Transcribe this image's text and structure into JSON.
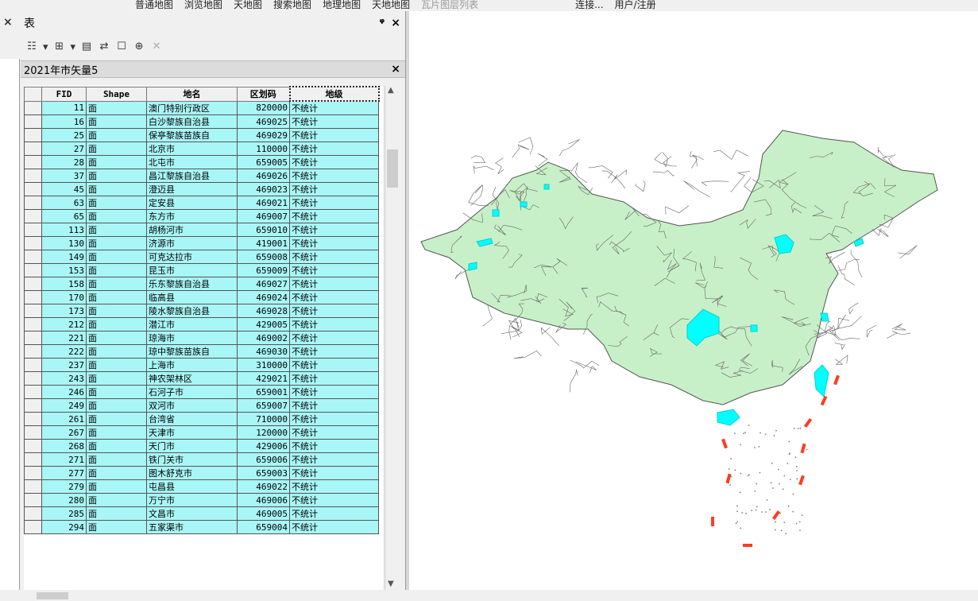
{
  "topbar": {
    "items": [
      "普通地图",
      "浏览地图",
      "天地图",
      "搜索地图",
      "地理地图",
      "天地地图"
    ],
    "search_placeholder": "瓦片图层列表",
    "items2": [
      "连接...",
      "用户/注册"
    ]
  },
  "left": {
    "close_label": "×"
  },
  "window": {
    "title": "表",
    "pin_label": "ᵠ",
    "close_label": "×"
  },
  "toolbar": {
    "delete_label": "✕"
  },
  "layer": {
    "name": "2021年市矢量5",
    "close_label": "×"
  },
  "table": {
    "columns": [
      "FID",
      "Shape",
      "地名",
      "区划码",
      "地级"
    ],
    "rows": [
      [
        "11",
        "面",
        "澳门特别行政区",
        "820000",
        "不统计"
      ],
      [
        "16",
        "面",
        "白沙黎族自治县",
        "469025",
        "不统计"
      ],
      [
        "25",
        "面",
        "保亭黎族苗族自",
        "469029",
        "不统计"
      ],
      [
        "27",
        "面",
        "北京市",
        "110000",
        "不统计"
      ],
      [
        "28",
        "面",
        "北屯市",
        "659005",
        "不统计"
      ],
      [
        "37",
        "面",
        "昌江黎族自治县",
        "469026",
        "不统计"
      ],
      [
        "45",
        "面",
        "澄迈县",
        "469023",
        "不统计"
      ],
      [
        "63",
        "面",
        "定安县",
        "469021",
        "不统计"
      ],
      [
        "65",
        "面",
        "东方市",
        "469007",
        "不统计"
      ],
      [
        "113",
        "面",
        "胡杨河市",
        "659010",
        "不统计"
      ],
      [
        "130",
        "面",
        "济源市",
        "419001",
        "不统计"
      ],
      [
        "149",
        "面",
        "可克达拉市",
        "659008",
        "不统计"
      ],
      [
        "153",
        "面",
        "昆玉市",
        "659009",
        "不统计"
      ],
      [
        "158",
        "面",
        "乐东黎族自治县",
        "469027",
        "不统计"
      ],
      [
        "170",
        "面",
        "临高县",
        "469024",
        "不统计"
      ],
      [
        "173",
        "面",
        "陵水黎族自治县",
        "469028",
        "不统计"
      ],
      [
        "212",
        "面",
        "潜江市",
        "429005",
        "不统计"
      ],
      [
        "221",
        "面",
        "琼海市",
        "469002",
        "不统计"
      ],
      [
        "222",
        "面",
        "琼中黎族苗族自",
        "469030",
        "不统计"
      ],
      [
        "237",
        "面",
        "上海市",
        "310000",
        "不统计"
      ],
      [
        "243",
        "面",
        "神农架林区",
        "429021",
        "不统计"
      ],
      [
        "246",
        "面",
        "石河子市",
        "659001",
        "不统计"
      ],
      [
        "249",
        "面",
        "双河市",
        "659007",
        "不统计"
      ],
      [
        "261",
        "面",
        "台湾省",
        "710000",
        "不统计"
      ],
      [
        "267",
        "面",
        "天津市",
        "120000",
        "不统计"
      ],
      [
        "268",
        "面",
        "天门市",
        "429006",
        "不统计"
      ],
      [
        "271",
        "面",
        "铁门关市",
        "659006",
        "不统计"
      ],
      [
        "277",
        "面",
        "图木舒克市",
        "659003",
        "不统计"
      ],
      [
        "279",
        "面",
        "屯昌县",
        "469022",
        "不统计"
      ],
      [
        "280",
        "面",
        "万宁市",
        "469006",
        "不统计"
      ],
      [
        "285",
        "面",
        "文昌市",
        "469005",
        "不统计"
      ],
      [
        "294",
        "面",
        "五家渠市",
        "659004",
        "不统计"
      ]
    ]
  },
  "colors": {
    "selected_row": "#a9f6f6",
    "land_fill": "#c8f0c8",
    "highlight": "#00ffff",
    "nine_dash": "#ff3b1f"
  }
}
